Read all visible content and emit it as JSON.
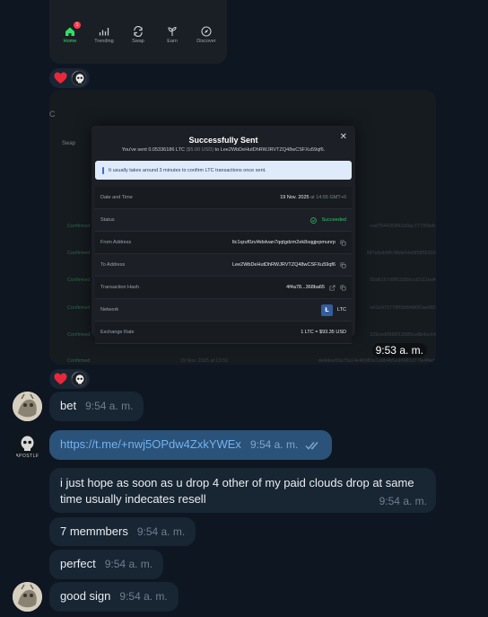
{
  "app_nav": {
    "items": [
      {
        "label": "Home",
        "icon": "home-icon",
        "badge": "1"
      },
      {
        "label": "Trending",
        "icon": "chart-icon"
      },
      {
        "label": "Swap",
        "icon": "swap-icon"
      },
      {
        "label": "Earn",
        "icon": "sprout-icon"
      },
      {
        "label": "Discover",
        "icon": "compass-icon"
      }
    ]
  },
  "colors": {
    "accent_green": "#2ee06a",
    "bubble_in": "#182533",
    "bubble_out": "#2b5278",
    "bg": "#0e1621"
  },
  "photo": {
    "time": "9:53 a. m.",
    "header_letter": "C",
    "swap_label": "Swap",
    "bg_rows": [
      {
        "status": "Confirmed",
        "hash": "ced75442f0842d3ac7779f3efc"
      },
      {
        "status": "Confirmed",
        "hash": "387a5eb6ffc98de64a5f5855316"
      },
      {
        "status": "Confirmed",
        "hash": "55d6167d0f03389ccd3111ed4"
      },
      {
        "status": "Confirmed",
        "hash": "e61e973778f03d9480f2ae082"
      },
      {
        "status": "Confirmed",
        "hash": "329ced0968f13985ce8b4cc64"
      },
      {
        "status": "Confirmed",
        "date": "19 Nov. 2025 at 23:51",
        "hash": "de4dee03a73a14e46981e1a9b4b5edd491d77fe4f4eff"
      }
    ],
    "modal": {
      "title": "Successfully Sent",
      "subtitle_pre": "You've sent 0.05336186 LTC ",
      "subtitle_usd": "($5.00 USD)",
      "subtitle_post": " to Lee2WbDeHutDhRWJRVTZQ48wCSFXu59qf6.",
      "info": "It usually takes around 3 minutes to confirm LTC transactions once sent.",
      "rows": [
        {
          "label": "Date and Time",
          "value": "19 Nov. 2025",
          "value_dim": " at 14:55 GMT+0"
        },
        {
          "label": "Status",
          "value": "Succeeded"
        },
        {
          "label": "From Address",
          "value": "ltc1qruf0zvl4dstvan7qqtgdzm2ek8sqgjepmunrp"
        },
        {
          "label": "To Address",
          "value": "Lee2WbDeHutDhRWJRVTZQ48wCSFXu59qf6"
        },
        {
          "label": "Transaction Hash",
          "value": "4f4a78...368ba65"
        },
        {
          "label": "Network",
          "value": "LTC"
        },
        {
          "label": "Exchange Rate",
          "value": "1 LTC = $93.35 USD"
        }
      ]
    }
  },
  "messages": [
    {
      "text": "bet",
      "time": "9:54 a. m."
    },
    {
      "text": "https://t.me/+nwj5OPdw4ZxkYWEx",
      "time": "9:54 a. m."
    },
    {
      "text": "i just hope as soon as u drop 4 other of my paid clouds drop at same time usually indecates resell",
      "time": "9:54 a. m."
    },
    {
      "text": "7 memmbers",
      "time": "9:54 a. m."
    },
    {
      "text": "perfect",
      "time": "9:54 a. m."
    },
    {
      "text": "good sign",
      "time": "9:54 a. m."
    }
  ],
  "avatar_caption": "APOSTLE"
}
